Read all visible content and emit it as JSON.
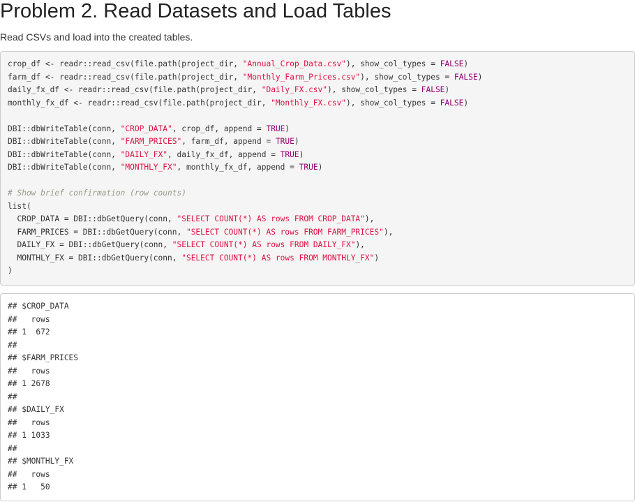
{
  "heading": {
    "title": "Problem 2. Read Datasets and Load Tables"
  },
  "description": "Read CSVs and load into the created tables.",
  "code_lines": [
    [
      {
        "t": "p",
        "v": "crop_df <- readr::read_csv(file.path(project_dir, "
      },
      {
        "t": "s",
        "v": "\"Annual_Crop_Data.csv\""
      },
      {
        "t": "p",
        "v": "), show_col_types = "
      },
      {
        "t": "k",
        "v": "FALSE"
      },
      {
        "t": "p",
        "v": ")"
      }
    ],
    [
      {
        "t": "p",
        "v": "farm_df <- readr::read_csv(file.path(project_dir, "
      },
      {
        "t": "s",
        "v": "\"Monthly_Farm_Prices.csv\""
      },
      {
        "t": "p",
        "v": "), show_col_types = "
      },
      {
        "t": "k",
        "v": "FALSE"
      },
      {
        "t": "p",
        "v": ")"
      }
    ],
    [
      {
        "t": "p",
        "v": "daily_fx_df <- readr::read_csv(file.path(project_dir, "
      },
      {
        "t": "s",
        "v": "\"Daily_FX.csv\""
      },
      {
        "t": "p",
        "v": "), show_col_types = "
      },
      {
        "t": "k",
        "v": "FALSE"
      },
      {
        "t": "p",
        "v": ")"
      }
    ],
    [
      {
        "t": "p",
        "v": "monthly_fx_df <- readr::read_csv(file.path(project_dir, "
      },
      {
        "t": "s",
        "v": "\"Monthly_FX.csv\""
      },
      {
        "t": "p",
        "v": "), show_col_types = "
      },
      {
        "t": "k",
        "v": "FALSE"
      },
      {
        "t": "p",
        "v": ")"
      }
    ],
    [],
    [
      {
        "t": "p",
        "v": "DBI::dbWriteTable(conn, "
      },
      {
        "t": "s",
        "v": "\"CROP_DATA\""
      },
      {
        "t": "p",
        "v": ", crop_df, append = "
      },
      {
        "t": "k",
        "v": "TRUE"
      },
      {
        "t": "p",
        "v": ")"
      }
    ],
    [
      {
        "t": "p",
        "v": "DBI::dbWriteTable(conn, "
      },
      {
        "t": "s",
        "v": "\"FARM_PRICES\""
      },
      {
        "t": "p",
        "v": ", farm_df, append = "
      },
      {
        "t": "k",
        "v": "TRUE"
      },
      {
        "t": "p",
        "v": ")"
      }
    ],
    [
      {
        "t": "p",
        "v": "DBI::dbWriteTable(conn, "
      },
      {
        "t": "s",
        "v": "\"DAILY_FX\""
      },
      {
        "t": "p",
        "v": ", daily_fx_df, append = "
      },
      {
        "t": "k",
        "v": "TRUE"
      },
      {
        "t": "p",
        "v": ")"
      }
    ],
    [
      {
        "t": "p",
        "v": "DBI::dbWriteTable(conn, "
      },
      {
        "t": "s",
        "v": "\"MONTHLY_FX\""
      },
      {
        "t": "p",
        "v": ", monthly_fx_df, append = "
      },
      {
        "t": "k",
        "v": "TRUE"
      },
      {
        "t": "p",
        "v": ")"
      }
    ],
    [],
    [
      {
        "t": "c",
        "v": "# Show brief confirmation (row counts)"
      }
    ],
    [
      {
        "t": "p",
        "v": "list("
      }
    ],
    [
      {
        "t": "p",
        "v": "  CROP_DATA = DBI::dbGetQuery(conn, "
      },
      {
        "t": "s",
        "v": "\"SELECT COUNT(*) AS rows FROM CROP_DATA\""
      },
      {
        "t": "p",
        "v": "),"
      }
    ],
    [
      {
        "t": "p",
        "v": "  FARM_PRICES = DBI::dbGetQuery(conn, "
      },
      {
        "t": "s",
        "v": "\"SELECT COUNT(*) AS rows FROM FARM_PRICES\""
      },
      {
        "t": "p",
        "v": "),"
      }
    ],
    [
      {
        "t": "p",
        "v": "  DAILY_FX = DBI::dbGetQuery(conn, "
      },
      {
        "t": "s",
        "v": "\"SELECT COUNT(*) AS rows FROM DAILY_FX\""
      },
      {
        "t": "p",
        "v": "),"
      }
    ],
    [
      {
        "t": "p",
        "v": "  MONTHLY_FX = DBI::dbGetQuery(conn, "
      },
      {
        "t": "s",
        "v": "\"SELECT COUNT(*) AS rows FROM MONTHLY_FX\""
      },
      {
        "t": "p",
        "v": ")"
      }
    ],
    [
      {
        "t": "p",
        "v": ")"
      }
    ]
  ],
  "output_lines": [
    "## $CROP_DATA",
    "##   rows",
    "## 1  672",
    "##",
    "## $FARM_PRICES",
    "##   rows",
    "## 1 2678",
    "##",
    "## $DAILY_FX",
    "##   rows",
    "## 1 1033",
    "##",
    "## $MONTHLY_FX",
    "##   rows",
    "## 1   50"
  ],
  "colors": {
    "string": "#dd1144",
    "keyword": "#990073",
    "comment": "#999988",
    "code_bg": "#f5f5f5"
  }
}
